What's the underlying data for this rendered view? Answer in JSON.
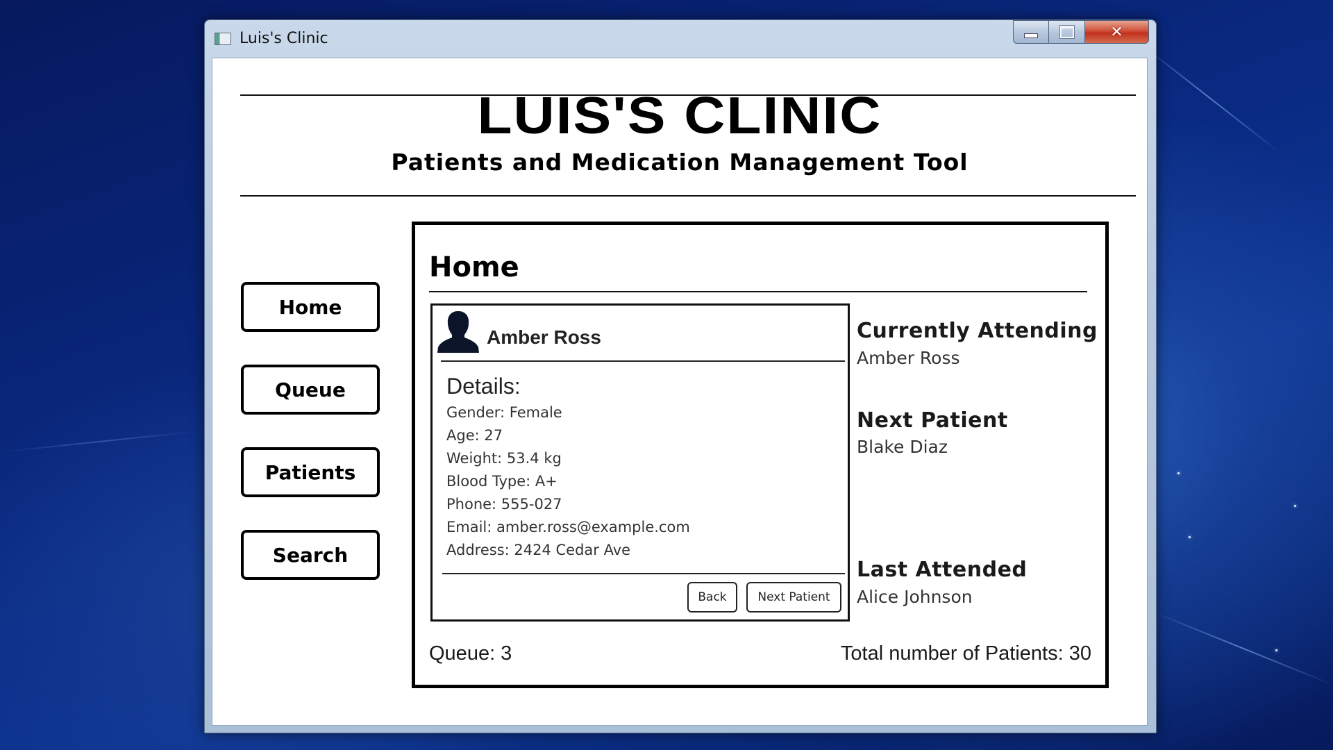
{
  "window": {
    "title": "Luis's Clinic",
    "close_glyph": "✕"
  },
  "header": {
    "title": "LUIS'S CLINIC",
    "subtitle": "Patients and Medication Management Tool"
  },
  "nav": {
    "items": [
      {
        "label": "Home"
      },
      {
        "label": "Queue"
      },
      {
        "label": "Patients"
      },
      {
        "label": "Search"
      }
    ]
  },
  "main": {
    "heading": "Home",
    "patient": {
      "name": "Amber Ross",
      "details_heading": "Details:",
      "details": [
        "Gender: Female",
        "Age: 27",
        "Weight: 53.4 kg",
        "Blood Type: A+",
        "Phone: 555-027",
        "Email: amber.ross@example.com",
        "Address: 2424 Cedar Ave"
      ],
      "back_label": "Back",
      "next_label": "Next Patient"
    },
    "currently_attending": {
      "heading": "Currently Attending",
      "value": "Amber Ross"
    },
    "next_patient": {
      "heading": "Next Patient",
      "value": "Blake Diaz"
    },
    "last_attended": {
      "heading": "Last Attended",
      "value": "Alice Johnson"
    },
    "queue_text": "Queue: 3",
    "total_text": "Total number of Patients: 30"
  },
  "icons": {
    "app": "clinic-app-icon",
    "avatar": "person-silhouette-icon"
  }
}
